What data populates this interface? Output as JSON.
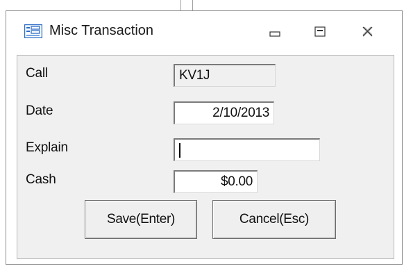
{
  "window": {
    "title": "Misc Transaction",
    "icon": "form-icon",
    "controls": [
      "minimize-icon",
      "restore-icon",
      "close-icon"
    ]
  },
  "form": {
    "call": {
      "label": "Call",
      "value": "KV1J",
      "readonly": true
    },
    "date": {
      "label": "Date",
      "value": "2/10/2013"
    },
    "explain": {
      "label": "Explain",
      "value": ""
    },
    "cash": {
      "label": "Cash",
      "value": "$0.00"
    }
  },
  "buttons": {
    "save": "Save(Enter)",
    "cancel": "Cancel(Esc)"
  },
  "colors": {
    "client_bg": "#f0f0f0",
    "window_border": "#8c8c8c",
    "icon_blue": "#2b6cc4"
  }
}
